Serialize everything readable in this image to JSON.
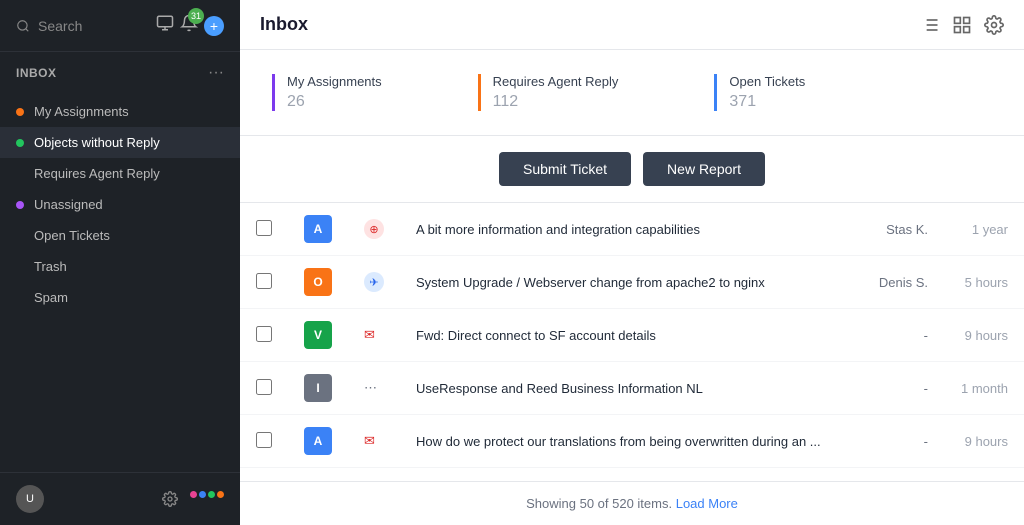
{
  "sidebar": {
    "search_placeholder": "Search",
    "badge_count": "31",
    "section_label": "INBOX",
    "nav_items": [
      {
        "id": "my-assignments",
        "label": "My Assignments",
        "dot": "orange",
        "active": false
      },
      {
        "id": "objects-without-reply",
        "label": "Objects without Reply",
        "dot": "green",
        "active": true
      },
      {
        "id": "requires-agent-reply",
        "label": "Requires Agent Reply",
        "dot": null,
        "active": false
      },
      {
        "id": "unassigned",
        "label": "Unassigned",
        "dot": "purple",
        "active": false
      },
      {
        "id": "open-tickets",
        "label": "Open Tickets",
        "dot": null,
        "active": false
      },
      {
        "id": "trash",
        "label": "Trash",
        "dot": null,
        "active": false
      },
      {
        "id": "spam",
        "label": "Spam",
        "dot": null,
        "active": false
      }
    ]
  },
  "header": {
    "title": "Inbox"
  },
  "stats": [
    {
      "id": "my-assignments",
      "label": "My Assignments",
      "value": "26",
      "color": "purple"
    },
    {
      "id": "requires-agent-reply",
      "label": "Requires Agent Reply",
      "value": "112",
      "color": "orange"
    },
    {
      "id": "open-tickets",
      "label": "Open Tickets",
      "value": "371",
      "color": "blue"
    }
  ],
  "actions": {
    "submit_label": "Submit Ticket",
    "new_report_label": "New Report"
  },
  "table": {
    "rows": [
      {
        "id": 1,
        "avatar_text": "A",
        "avatar_color": "av-blue",
        "badge_type": "lifebuoy",
        "subject": "A bit more information and integration capabilities",
        "agent": "Stas K.",
        "time": "1 year"
      },
      {
        "id": 2,
        "avatar_text": "O",
        "avatar_color": "av-orange",
        "badge_type": "telegram",
        "subject": "System Upgrade / Webserver change from apache2 to nginx",
        "agent": "Denis S.",
        "time": "5 hours"
      },
      {
        "id": 3,
        "avatar_text": "V",
        "avatar_color": "av-green",
        "badge_type": "email",
        "subject": "Fwd: Direct connect to SF account details",
        "agent": "-",
        "time": "9 hours"
      },
      {
        "id": 4,
        "avatar_text": "I",
        "avatar_color": "av-gray",
        "badge_type": "chat",
        "subject": "UseResponse and Reed Business Information NL",
        "agent": "-",
        "time": "1 month"
      },
      {
        "id": 5,
        "avatar_text": "A",
        "avatar_color": "av-blue",
        "badge_type": "email",
        "subject": "How do we protect our translations from being overwritten during an ...",
        "agent": "-",
        "time": "9 hours"
      }
    ],
    "footer_text": "Showing 50 of 520 items.",
    "load_more_label": "Load More"
  }
}
